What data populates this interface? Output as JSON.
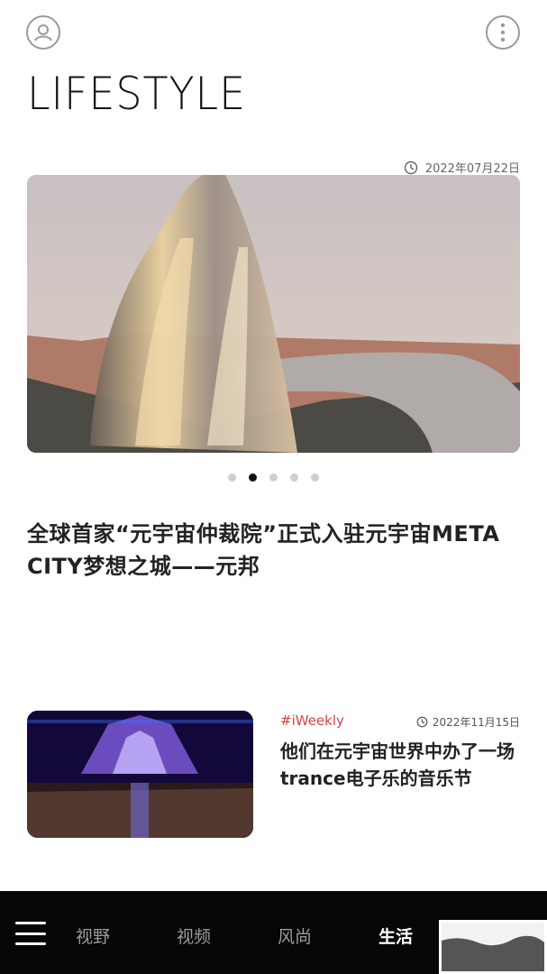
{
  "header": {
    "title": "LIFESTYLE",
    "profile_icon": "profile-icon",
    "more_icon": "more-vertical-icon"
  },
  "featured": {
    "date": "2022年07月22日",
    "headline": "全球首家“元宇宙仲裁院”正式入驻元宇宙META CITY梦想之城——元邦",
    "carousel": {
      "count": 5,
      "active_index": 1
    }
  },
  "article_card": {
    "tag": "#iWeekly",
    "date": "2022年11月15日",
    "title": "他们在元宇宙世界中办了一场trance电子乐的音乐节"
  },
  "bottom_nav": {
    "menu_icon": "hamburger-menu-icon",
    "items": [
      {
        "label": "视野",
        "active": false
      },
      {
        "label": "视频",
        "active": false
      },
      {
        "label": "风尚",
        "active": false
      },
      {
        "label": "生活",
        "active": true
      }
    ]
  },
  "colors": {
    "accent_tag": "#d64545",
    "nav_bg": "#060606"
  }
}
